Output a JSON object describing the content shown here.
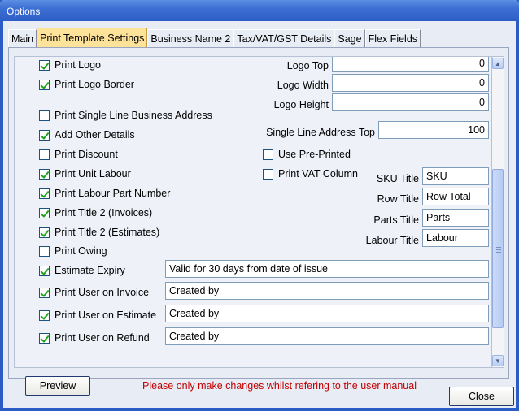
{
  "window": {
    "title": "Options"
  },
  "tabs": [
    {
      "label": "Main",
      "active": false
    },
    {
      "label": "Print Template Settings",
      "active": true
    },
    {
      "label": "Business Name 2",
      "active": false
    },
    {
      "label": "Tax/VAT/GST Details",
      "active": false
    },
    {
      "label": "Sage",
      "active": false
    },
    {
      "label": "Flex Fields",
      "active": false
    }
  ],
  "checkboxes_left": [
    {
      "label": "Print Logo",
      "checked": true
    },
    {
      "label": "Print Logo Border",
      "checked": true
    },
    {
      "label": "Print Single Line Business Address",
      "checked": false
    },
    {
      "label": "Add Other Details",
      "checked": true
    },
    {
      "label": "Print Discount",
      "checked": false
    },
    {
      "label": "Print Unit Labour",
      "checked": true
    },
    {
      "label": "Print Labour Part Number",
      "checked": true
    },
    {
      "label": "Print Title 2 (Invoices)",
      "checked": true
    },
    {
      "label": "Print Title 2 (Estimates)",
      "checked": true
    },
    {
      "label": "Print Owing",
      "checked": false
    },
    {
      "label": "Estimate Expiry",
      "checked": true
    },
    {
      "label": "Print User on Invoice",
      "checked": true
    },
    {
      "label": "Print User on Estimate",
      "checked": true
    },
    {
      "label": "Print User on Refund",
      "checked": true
    }
  ],
  "checkboxes_right": [
    {
      "label": "Use Pre-Printed",
      "checked": false
    },
    {
      "label": "Print VAT Column",
      "checked": false
    }
  ],
  "logo_fields": {
    "logo_top_label": "Logo Top",
    "logo_top_value": "0",
    "logo_width_label": "Logo Width",
    "logo_width_value": "0",
    "logo_height_label": "Logo Height",
    "logo_height_value": "0",
    "single_line_label": "Single Line Address Top",
    "single_line_value": "100"
  },
  "title_fields": {
    "sku_label": "SKU Title",
    "sku_value": "SKU",
    "row_label": "Row Title",
    "row_value": "Row Total",
    "parts_label": "Parts Title",
    "parts_value": "Parts",
    "labour_label": "Labour Title",
    "labour_value": "Labour"
  },
  "text_fields": {
    "estimate_expiry": "Valid for 30 days from date of issue",
    "user_invoice": "Created by",
    "user_estimate": "Created by",
    "user_refund": "Created by"
  },
  "footer": {
    "preview_label": "Preview",
    "warning": "Please only make changes whilst refering to the user manual",
    "close_label": "Close"
  },
  "colors": {
    "warning": "#c40000",
    "active_tab": "#fde39a",
    "check": "#21a121"
  }
}
